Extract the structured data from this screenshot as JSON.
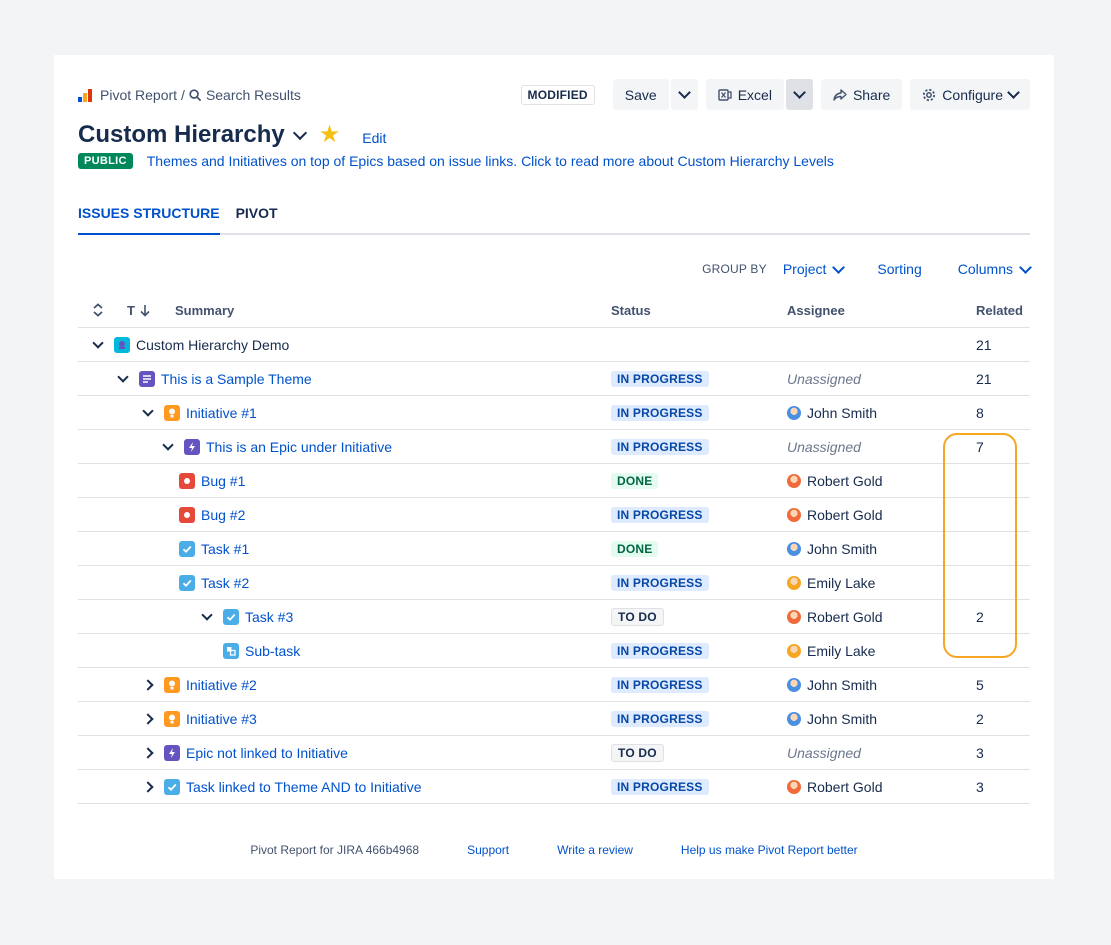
{
  "breadcrumb": {
    "root": "Pivot Report",
    "separator": "/",
    "current": "Search Results"
  },
  "toolbar": {
    "modified_badge": "MODIFIED",
    "save_label": "Save",
    "excel_label": "Excel",
    "share_label": "Share",
    "configure_label": "Configure"
  },
  "report": {
    "title": "Custom Hierarchy",
    "edit_label": "Edit",
    "visibility": "PUBLIC",
    "description": "Themes and Initiatives on top of Epics based on issue links. Click to read more about Custom Hierarchy Levels"
  },
  "tabs": [
    {
      "label": "ISSUES STRUCTURE",
      "active": true
    },
    {
      "label": "PIVOT",
      "active": false
    }
  ],
  "group_bar": {
    "group_by_label": "GROUP BY",
    "group_by_value": "Project",
    "sorting_label": "Sorting",
    "columns_label": "Columns"
  },
  "table": {
    "headers": {
      "type": "T",
      "summary": "Summary",
      "status": "Status",
      "assignee": "Assignee",
      "related": "Related"
    },
    "rows": [
      {
        "summary": "Custom Hierarchy Demo",
        "status": "",
        "assignee": "",
        "related": "21"
      },
      {
        "summary": "This is a Sample Theme",
        "status": "IN PROGRESS",
        "assignee": "Unassigned",
        "related": "21"
      },
      {
        "summary": "Initiative #1",
        "status": "IN PROGRESS",
        "assignee": "John Smith",
        "related": "8"
      },
      {
        "summary": "This is an Epic under Initiative",
        "status": "IN PROGRESS",
        "assignee": "Unassigned",
        "related": "7"
      },
      {
        "summary": "Bug #1",
        "status": "DONE",
        "assignee": "Robert Gold",
        "related": ""
      },
      {
        "summary": "Bug #2",
        "status": "IN PROGRESS",
        "assignee": "Robert Gold",
        "related": ""
      },
      {
        "summary": "Task #1",
        "status": "DONE",
        "assignee": "John Smith",
        "related": ""
      },
      {
        "summary": "Task #2",
        "status": "IN PROGRESS",
        "assignee": "Emily Lake",
        "related": ""
      },
      {
        "summary": "Task #3",
        "status": "TO DO",
        "assignee": "Robert Gold",
        "related": "2"
      },
      {
        "summary": "Sub-task",
        "status": "IN PROGRESS",
        "assignee": "Emily Lake",
        "related": ""
      },
      {
        "summary": "Initiative #2",
        "status": "IN PROGRESS",
        "assignee": "John Smith",
        "related": "5"
      },
      {
        "summary": "Initiative #3",
        "status": "IN PROGRESS",
        "assignee": "John Smith",
        "related": "2"
      },
      {
        "summary": "Epic not linked to Initiative",
        "status": "TO DO",
        "assignee": "Unassigned",
        "related": "3"
      },
      {
        "summary": "Task linked to Theme AND to Initiative",
        "status": "IN PROGRESS",
        "assignee": "Robert Gold",
        "related": "3"
      }
    ]
  },
  "footer": {
    "product": "Pivot Report for JIRA 466b4968",
    "support": "Support",
    "review": "Write a review",
    "feedback": "Help us make Pivot Report better"
  }
}
